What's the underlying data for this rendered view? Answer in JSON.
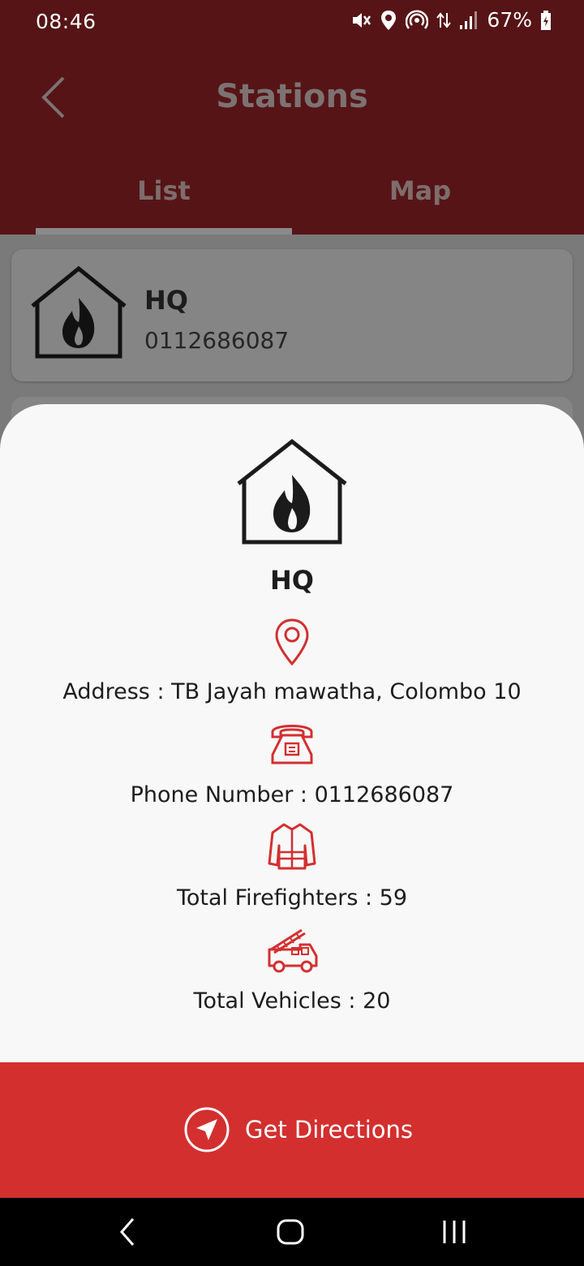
{
  "status_bar": {
    "time": "08:46",
    "battery": "67%",
    "icons": [
      "mute-icon",
      "location-icon",
      "hotspot-icon",
      "data-arrows-icon",
      "signal-icon",
      "battery-icon"
    ]
  },
  "header": {
    "title": "Stations",
    "tabs": [
      {
        "label": "List",
        "active": true
      },
      {
        "label": "Map",
        "active": false
      }
    ]
  },
  "list": {
    "stations": [
      {
        "name": "HQ",
        "phone": "0112686087",
        "icon": "fire-station-icon"
      }
    ]
  },
  "sheet": {
    "name": "HQ",
    "address": "Address : TB Jayah mawatha, Colombo 10",
    "phone": "Phone Number : 0112686087",
    "firefighters": "Total Firefighters : 59",
    "vehicles": "Total Vehicles : 20",
    "icons": [
      "location-pin-icon",
      "telephone-icon",
      "firefighter-jacket-icon",
      "fire-truck-icon"
    ]
  },
  "actions": {
    "directions_label": "Get Directions",
    "directions_icon": "navigation-arrow-icon"
  },
  "nav": {
    "buttons": [
      "back-nav-icon",
      "home-nav-icon",
      "recents-nav-icon"
    ]
  },
  "colors": {
    "header_bg": "#561416",
    "accent_red": "#d32f2f",
    "icon_red": "#d32f2f",
    "sheet_bg": "#f8f8f8"
  }
}
